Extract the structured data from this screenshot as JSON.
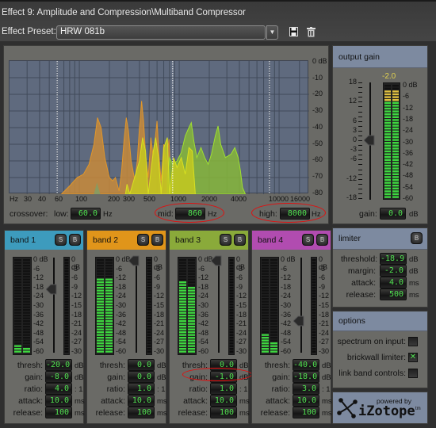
{
  "window": {
    "title": "Effect 9: Amplitude and Compression\\Multiband Compressor",
    "preset_label": "Effect Preset:",
    "preset_value": "HRW 081b",
    "icons": [
      "save-icon",
      "delete-icon"
    ]
  },
  "spectrum": {
    "db_scale": [
      "0 dB",
      "-10",
      "-20",
      "-30",
      "-40",
      "-50",
      "-60",
      "-70",
      "-80"
    ],
    "hz_scale": [
      "Hz",
      "30",
      "40",
      "60",
      "100",
      "200",
      "300",
      "500",
      "1000",
      "2000",
      "4000",
      "10000",
      "16000"
    ],
    "crossover_label": "crossover:",
    "low_label": "low:",
    "low_value": "60.0",
    "mid_label": "mid:",
    "mid_value": "860",
    "high_label": "high:",
    "high_value": "8000",
    "unit": "Hz"
  },
  "output_gain": {
    "title": "output gain",
    "peak_value": "-2.0",
    "slider_scale": [
      "18",
      "12",
      "6",
      "3",
      "0",
      "-3",
      "-6",
      "-12",
      "-18"
    ],
    "meter_scale": [
      "0 dB",
      "-6",
      "-12",
      "-18",
      "-24",
      "-30",
      "-36",
      "-42",
      "-48",
      "-54",
      "-60"
    ],
    "gain_label": "gain:",
    "gain_value": "0.0",
    "gain_unit": "dB",
    "slider_value_db": 0
  },
  "band_scales": {
    "input": [
      "0 dB",
      "-6",
      "-12",
      "-18",
      "-24",
      "-30",
      "-36",
      "-42",
      "-48",
      "-54",
      "-60"
    ],
    "gr": [
      "0 dB",
      "-3",
      "-6",
      "-9",
      "-12",
      "-15",
      "-18",
      "-21",
      "-24",
      "-27",
      "-30"
    ]
  },
  "bands": [
    {
      "title": "band 1",
      "color": "#3d9bbd",
      "solo": "S",
      "bypass": "B",
      "thresh": "-20.0",
      "gain": "-8.0",
      "ratio": "4.0",
      "attack": "10.0",
      "release": "100",
      "meter_level_db": -54,
      "thresh_db": -20
    },
    {
      "title": "band 2",
      "color": "#e0951a",
      "solo": "S",
      "bypass": "B",
      "thresh": "0.0",
      "gain": "0.0",
      "ratio": "1.0",
      "attack": "10.0",
      "release": "100",
      "meter_level_db": -12,
      "thresh_db": 0
    },
    {
      "title": "band 3",
      "color": "#8aaa3a",
      "solo": "S",
      "bypass": "B",
      "thresh": "0.0",
      "gain": "-1.0",
      "ratio": "1.0",
      "attack": "10.0",
      "release": "100",
      "meter_level_db": -14,
      "thresh_db": 0
    },
    {
      "title": "band 4",
      "color": "#b14cb0",
      "solo": "S",
      "bypass": "B",
      "thresh": "-40.0",
      "gain": "-18.0",
      "ratio": "3.0",
      "attack": "10.0",
      "release": "100",
      "meter_level_db": -48,
      "thresh_db": -40
    }
  ],
  "param_labels": {
    "thresh": "thresh:",
    "gain": "gain:",
    "ratio": "ratio:",
    "attack": "attack:",
    "release": "release:"
  },
  "param_units": {
    "thresh": "dB",
    "gain": "dB",
    "ratio": ": 1",
    "attack": "ms",
    "release": "ms"
  },
  "limiter": {
    "title": "limiter",
    "bypass": "B",
    "threshold_label": "threshold:",
    "threshold": "-18.9",
    "threshold_unit": "dB",
    "margin_label": "margin:",
    "margin": "-2.0",
    "margin_unit": "dB",
    "attack_label": "attack:",
    "attack": "4.0",
    "attack_unit": "ms",
    "release_label": "release:",
    "release": "500",
    "release_unit": "ms"
  },
  "options": {
    "title": "options",
    "items": [
      {
        "label": "spectrum on input:",
        "checked": false
      },
      {
        "label": "brickwall limiter:",
        "checked": true
      },
      {
        "label": "link band controls:",
        "checked": false
      }
    ]
  },
  "logo": {
    "powered_by": "powered by",
    "brand": "iZotope",
    "tm": "tm"
  }
}
